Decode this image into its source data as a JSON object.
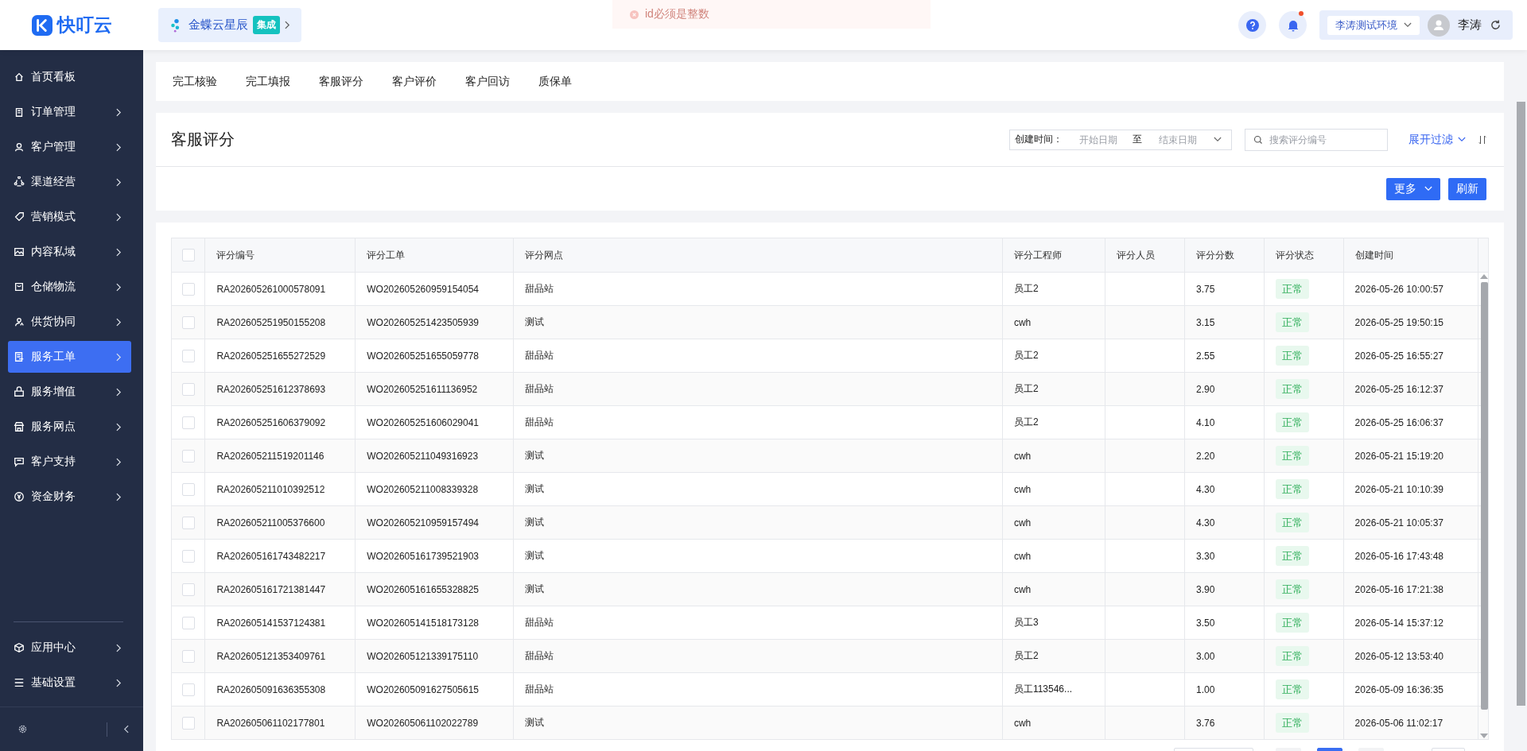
{
  "header": {
    "logo": "快叮云",
    "integration": {
      "name": "金蝶云星辰",
      "badge": "集成"
    },
    "toast": "id必须是整数",
    "environment": "李涛测试环境",
    "user": "李涛",
    "notification_dot": true
  },
  "sidebar": {
    "items": [
      {
        "label": "首页看板",
        "selected": false,
        "expandable": false
      },
      {
        "label": "订单管理",
        "selected": false,
        "expandable": true
      },
      {
        "label": "客户管理",
        "selected": false,
        "expandable": true
      },
      {
        "label": "渠道经营",
        "selected": false,
        "expandable": true
      },
      {
        "label": "营销模式",
        "selected": false,
        "expandable": true
      },
      {
        "label": "内容私域",
        "selected": false,
        "expandable": true
      },
      {
        "label": "仓储物流",
        "selected": false,
        "expandable": true
      },
      {
        "label": "供货协同",
        "selected": false,
        "expandable": true
      },
      {
        "label": "服务工单",
        "selected": true,
        "expandable": true
      },
      {
        "label": "服务增值",
        "selected": false,
        "expandable": true
      },
      {
        "label": "服务网点",
        "selected": false,
        "expandable": true
      },
      {
        "label": "客户支持",
        "selected": false,
        "expandable": true
      },
      {
        "label": "资金财务",
        "selected": false,
        "expandable": true
      }
    ],
    "bottom_items": [
      {
        "label": "应用中心",
        "selected": false,
        "expandable": true
      },
      {
        "label": "基础设置",
        "selected": false,
        "expandable": true
      }
    ]
  },
  "tabs": [
    {
      "label": "完工核验",
      "selected": false
    },
    {
      "label": "完工填报",
      "selected": false
    },
    {
      "label": "客服评分",
      "selected": false
    },
    {
      "label": "客户评价",
      "selected": false
    },
    {
      "label": "客户回访",
      "selected": false
    },
    {
      "label": "质保单",
      "selected": false
    }
  ],
  "page_title": "客服评分",
  "filters": {
    "date_label": "创建时间：",
    "start_placeholder": "开始日期",
    "separator": "至",
    "end_placeholder": "结束日期",
    "search_placeholder": "搜索评分编号",
    "expand_filter": "展开过滤"
  },
  "actions": [
    "更多",
    "刷新"
  ],
  "table": {
    "all_checked": false,
    "columns": [
      "评分编号",
      "评分工单",
      "评分网点",
      "评分工程师",
      "评分人员",
      "评分分数",
      "评分状态",
      "创建时间"
    ],
    "rows": [
      {
        "checked": false,
        "cells": [
          "RA202605261000578091",
          "WO202605260959154054",
          "甜品站",
          "员工2",
          "",
          "3.75",
          "正常",
          "2026-05-26 10:00:57"
        ]
      },
      {
        "checked": false,
        "cells": [
          "RA202605251950155208",
          "WO202605251423505939",
          "测试",
          "cwh",
          "",
          "3.15",
          "正常",
          "2026-05-25 19:50:15"
        ]
      },
      {
        "checked": false,
        "cells": [
          "RA202605251655272529",
          "WO202605251655059778",
          "甜品站",
          "员工2",
          "",
          "2.55",
          "正常",
          "2026-05-25 16:55:27"
        ]
      },
      {
        "checked": false,
        "cells": [
          "RA202605251612378693",
          "WO202605251611136952",
          "甜品站",
          "员工2",
          "",
          "2.90",
          "正常",
          "2026-05-25 16:12:37"
        ]
      },
      {
        "checked": false,
        "cells": [
          "RA202605251606379092",
          "WO202605251606029041",
          "甜品站",
          "员工2",
          "",
          "4.10",
          "正常",
          "2026-05-25 16:06:37"
        ]
      },
      {
        "checked": false,
        "cells": [
          "RA202605211519201146",
          "WO202605211049316923",
          "测试",
          "cwh",
          "",
          "2.20",
          "正常",
          "2026-05-21 15:19:20"
        ]
      },
      {
        "checked": false,
        "cells": [
          "RA202605211010392512",
          "WO202605211008339328",
          "测试",
          "cwh",
          "",
          "4.30",
          "正常",
          "2026-05-21 10:10:39"
        ]
      },
      {
        "checked": false,
        "cells": [
          "RA202605211005376600",
          "WO202605210959157494",
          "测试",
          "cwh",
          "",
          "4.30",
          "正常",
          "2026-05-21 10:05:37"
        ]
      },
      {
        "checked": false,
        "cells": [
          "RA202605161743482217",
          "WO202605161739521903",
          "测试",
          "cwh",
          "",
          "3.30",
          "正常",
          "2026-05-16 17:43:48"
        ]
      },
      {
        "checked": false,
        "cells": [
          "RA202605161721381447",
          "WO202605161655328825",
          "测试",
          "cwh",
          "",
          "3.90",
          "正常",
          "2026-05-16 17:21:38"
        ]
      },
      {
        "checked": false,
        "cells": [
          "RA202605141537124381",
          "WO202605141518173128",
          "甜品站",
          "员工3",
          "",
          "3.50",
          "正常",
          "2026-05-14 15:37:12"
        ]
      },
      {
        "checked": false,
        "cells": [
          "RA202605121353409761",
          "WO202605121339175110",
          "甜品站",
          "员工2",
          "",
          "3.00",
          "正常",
          "2026-05-12 13:53:40"
        ]
      },
      {
        "checked": false,
        "cells": [
          "RA202605091636355308",
          "WO202605091627505615",
          "甜品站",
          "员工113546...",
          "",
          "1.00",
          "正常",
          "2026-05-09 16:36:35"
        ]
      },
      {
        "checked": false,
        "cells": [
          "RA202605061102177801",
          "WO202605061102022789",
          "测试",
          "cwh",
          "",
          "3.76",
          "正常",
          "2026-05-06 11:02:17"
        ]
      }
    ]
  },
  "pagination": [
    {
      "kind": "size-select"
    },
    {
      "kind": "page",
      "selected": false
    },
    {
      "kind": "page",
      "selected": true
    },
    {
      "kind": "page",
      "selected": false
    },
    {
      "kind": "jump"
    }
  ]
}
